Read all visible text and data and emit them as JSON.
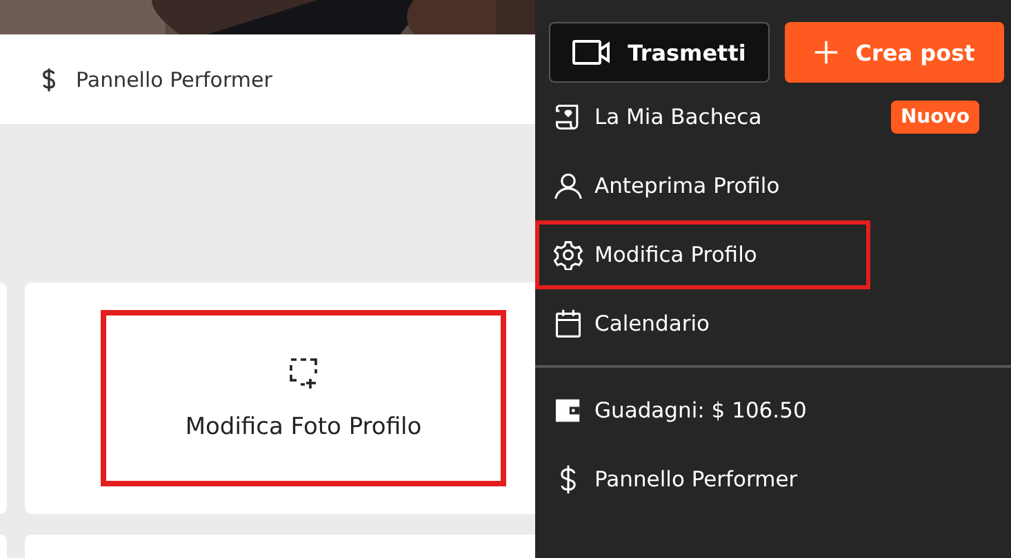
{
  "header": {
    "link": {
      "label": "Pannello Performer"
    }
  },
  "cards": [
    {
      "label": "Modifica Foto Profilo",
      "highlighted": true
    }
  ],
  "menu": {
    "buttons": [
      {
        "kind": "secondary",
        "label": "Trasmetti"
      },
      {
        "kind": "primary",
        "label": "Crea post"
      }
    ],
    "items": [
      {
        "label": "La Mia Bacheca",
        "badge": "Nuovo",
        "highlighted": false
      },
      {
        "label": "Anteprima Profilo",
        "highlighted": false
      },
      {
        "label": "Modifica Profilo",
        "highlighted": true
      },
      {
        "label": "Calendario",
        "highlighted": false
      },
      {
        "kind": "divider"
      },
      {
        "label": "Guadagni: $ 106.50",
        "highlighted": false
      },
      {
        "label": "Pannello Performer",
        "highlighted": false
      }
    ]
  }
}
